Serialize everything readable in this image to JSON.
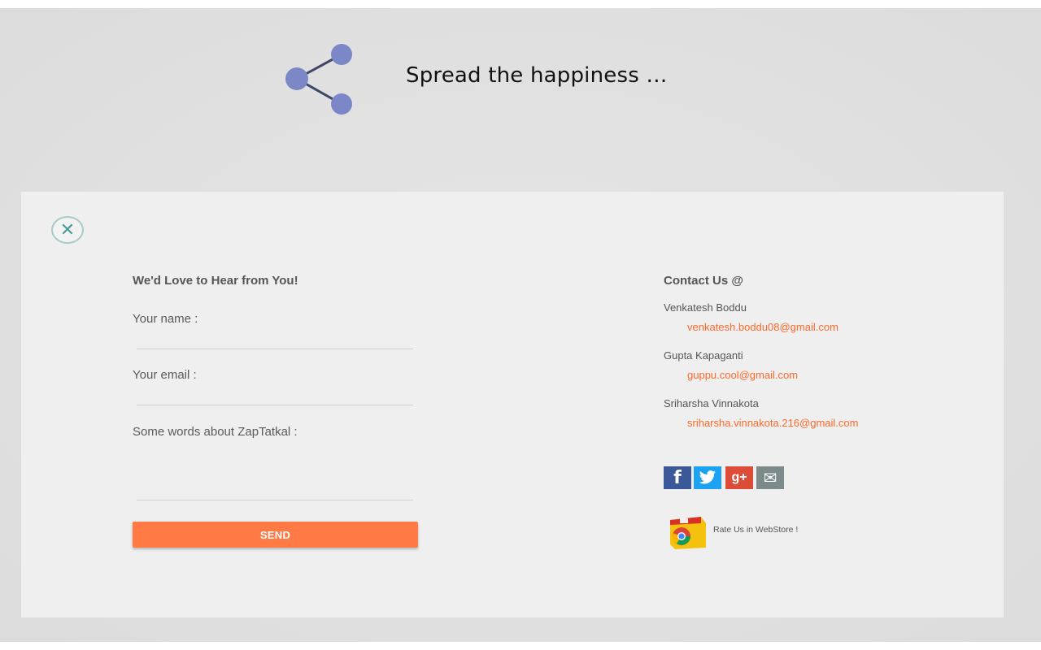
{
  "header": {
    "tagline": "Spread the happiness …",
    "icon": "share-icon",
    "icon_color": "#7b87c7"
  },
  "dialog": {
    "close_icon": "close-icon",
    "form": {
      "title": "We'd Love to Hear from You!",
      "name_label": "Your name :",
      "name_value": "",
      "email_label": "Your email :",
      "email_value": "",
      "message_label": "Some words about ZapTatkal :",
      "message_value": "",
      "send_label": "SEND",
      "send_color": "#ff7a45"
    },
    "contact": {
      "title": "Contact Us @",
      "people": [
        {
          "name": "Venkatesh Boddu",
          "email": "venkatesh.boddu08@gmail.com"
        },
        {
          "name": "Gupta Kapaganti",
          "email": "guppu.cool@gmail.com"
        },
        {
          "name": "Sriharsha Vinnakota",
          "email": "sriharsha.vinnakota.216@gmail.com"
        }
      ],
      "email_color": "#ff6a2b",
      "social": [
        {
          "icon": "facebook-icon",
          "glyph": "f",
          "color": "#3b5998"
        },
        {
          "icon": "twitter-icon",
          "glyph": "t",
          "color": "#1da1f2"
        },
        {
          "icon": "google-plus-icon",
          "glyph": "g+",
          "color": "#dd4b39"
        },
        {
          "icon": "mail-icon",
          "glyph": "✉",
          "color": "#7d8a8c"
        }
      ],
      "rate_label": "Rate Us in WebStore !",
      "rate_icon": "chrome-webstore-icon"
    }
  }
}
